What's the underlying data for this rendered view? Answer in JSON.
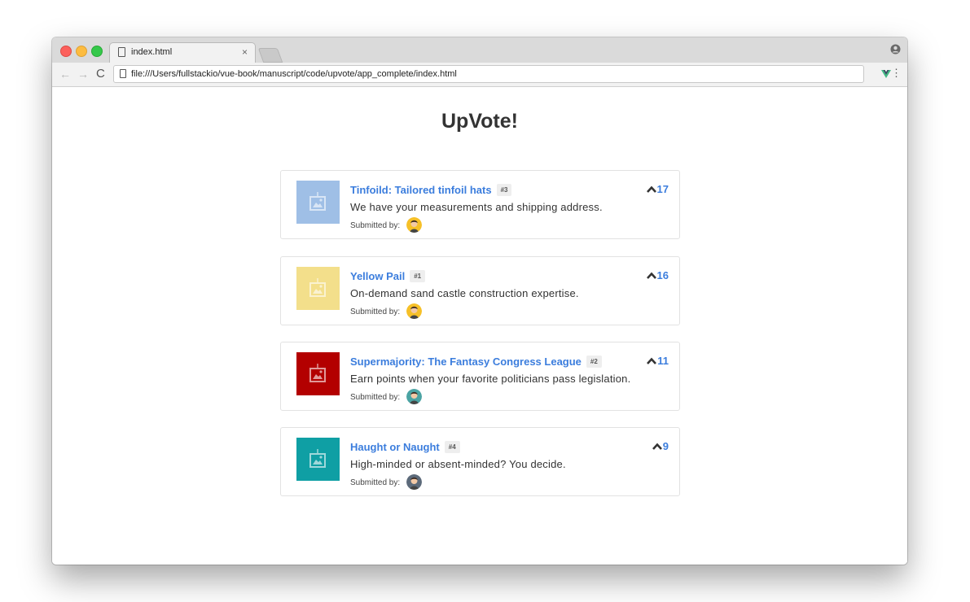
{
  "browser": {
    "tab_title": "index.html",
    "tab_close": "×",
    "url": "file:///Users/fullstackio/vue-book/manuscript/code/upvote/app_complete/index.html",
    "back_icon": "←",
    "forward_icon": "→",
    "reload_icon": "C",
    "menu_icon": "⋮"
  },
  "app": {
    "title": "UpVote!",
    "submitted_label": "Submitted by:",
    "posts": [
      {
        "title": "Tinfoild: Tailored tinfoil hats",
        "id_badge": "#3",
        "description": "We have your measurements and shipping address.",
        "votes": "17",
        "thumb_color": "#9fbfe6",
        "avatar_color": "#f6c028"
      },
      {
        "title": "Yellow Pail",
        "id_badge": "#1",
        "description": "On-demand sand castle construction expertise.",
        "votes": "16",
        "thumb_color": "#f3df8b",
        "avatar_color": "#f6c028"
      },
      {
        "title": "Supermajority: The Fantasy Congress League",
        "id_badge": "#2",
        "description": "Earn points when your favorite politicians pass legislation.",
        "votes": "11",
        "thumb_color": "#b30000",
        "avatar_color": "#4aa3a3"
      },
      {
        "title": "Haught or Naught",
        "id_badge": "#4",
        "description": "High-minded or absent-minded? You decide.",
        "votes": "9",
        "thumb_color": "#0f9fa4",
        "avatar_color": "#5c6a7a"
      }
    ]
  },
  "colors": {
    "link": "#3b7ddd",
    "title": "#333333"
  }
}
